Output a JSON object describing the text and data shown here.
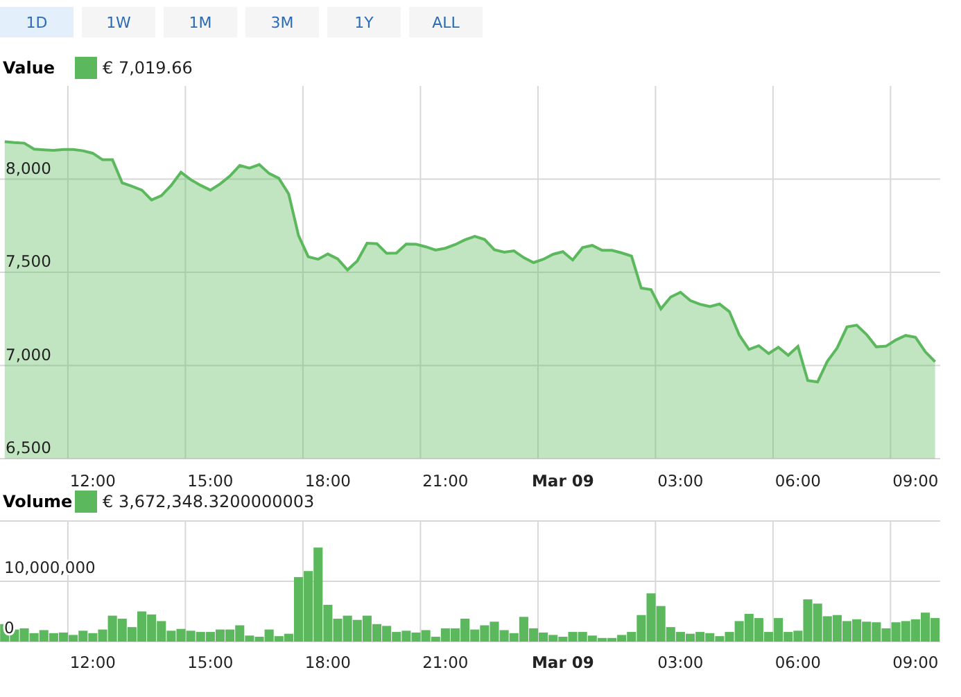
{
  "range_buttons": [
    {
      "label": "1D",
      "selected": true
    },
    {
      "label": "1W",
      "selected": false
    },
    {
      "label": "1M",
      "selected": false
    },
    {
      "label": "3M",
      "selected": false
    },
    {
      "label": "1Y",
      "selected": false
    },
    {
      "label": "ALL",
      "selected": false
    }
  ],
  "value_panel": {
    "legend_value": "€ 7,019.66",
    "chart_data": {
      "type": "area",
      "grid": true,
      "ylim": [
        6500,
        8500
      ],
      "yticks": [
        {
          "value": 6500,
          "label": "6,500"
        },
        {
          "value": 7000,
          "label": "7,000"
        },
        {
          "value": 7500,
          "label": "7,500"
        },
        {
          "value": 8000,
          "label": "8,000"
        }
      ],
      "categories": [
        null,
        null,
        null,
        null,
        null,
        null,
        null,
        null,
        null,
        "12:00",
        null,
        null,
        null,
        null,
        null,
        null,
        null,
        null,
        null,
        null,
        null,
        "15:00",
        null,
        null,
        null,
        null,
        null,
        null,
        null,
        null,
        null,
        null,
        null,
        "18:00",
        null,
        null,
        null,
        null,
        null,
        null,
        null,
        null,
        null,
        null,
        null,
        "21:00",
        null,
        null,
        null,
        null,
        null,
        null,
        null,
        null,
        null,
        null,
        null,
        "Mar 09",
        null,
        null,
        null,
        null,
        null,
        null,
        null,
        null,
        null,
        null,
        null,
        "03:00",
        null,
        null,
        null,
        null,
        null,
        null,
        null,
        null,
        null,
        null,
        null,
        "06:00",
        null,
        null,
        null,
        null,
        null,
        null,
        null,
        null,
        null,
        null,
        null,
        "09:00",
        null,
        null
      ],
      "series": [
        {
          "name": "Value",
          "color": "#5cb85c",
          "values": [
            8200,
            8196,
            8193,
            8161,
            8157,
            8154,
            8159,
            8159,
            8152,
            8139,
            8104,
            8104,
            7980,
            7962,
            7941,
            7888,
            7911,
            7966,
            8037,
            7997,
            7967,
            7941,
            7974,
            8017,
            8073,
            8059,
            8078,
            8030,
            8004,
            7920,
            7696,
            7583,
            7570,
            7598,
            7572,
            7513,
            7560,
            7656,
            7653,
            7602,
            7603,
            7652,
            7650,
            7637,
            7619,
            7629,
            7649,
            7674,
            7693,
            7676,
            7621,
            7608,
            7615,
            7579,
            7552,
            7570,
            7597,
            7611,
            7566,
            7632,
            7644,
            7618,
            7618,
            7604,
            7587,
            7415,
            7407,
            7304,
            7367,
            7393,
            7348,
            7328,
            7316,
            7330,
            7289,
            7163,
            7086,
            7106,
            7064,
            7098,
            7055,
            7102,
            6919,
            6912,
            7022,
            7094,
            7207,
            7216,
            7166,
            7100,
            7104,
            7137,
            7161,
            7151,
            7073,
            7020
          ]
        }
      ]
    }
  },
  "volume_panel": {
    "legend_value": "€ 3,672,348.3200000003",
    "chart_data": {
      "type": "bar",
      "grid": true,
      "ylim": [
        0,
        20000000
      ],
      "yticks": [
        {
          "value": 0,
          "label": "0"
        },
        {
          "value": 10000000,
          "label": "10,000,000"
        }
      ],
      "categories": [
        null,
        null,
        null,
        null,
        null,
        null,
        null,
        null,
        null,
        "12:00",
        null,
        null,
        null,
        null,
        null,
        null,
        null,
        null,
        null,
        null,
        null,
        "15:00",
        null,
        null,
        null,
        null,
        null,
        null,
        null,
        null,
        null,
        null,
        null,
        "18:00",
        null,
        null,
        null,
        null,
        null,
        null,
        null,
        null,
        null,
        null,
        null,
        "21:00",
        null,
        null,
        null,
        null,
        null,
        null,
        null,
        null,
        null,
        null,
        null,
        "Mar 09",
        null,
        null,
        null,
        null,
        null,
        null,
        null,
        null,
        null,
        null,
        null,
        "03:00",
        null,
        null,
        null,
        null,
        null,
        null,
        null,
        null,
        null,
        null,
        null,
        "06:00",
        null,
        null,
        null,
        null,
        null,
        null,
        null,
        null,
        null,
        null,
        null,
        "09:00",
        null,
        null
      ],
      "series": [
        {
          "name": "Volume",
          "color": "#5cb85c",
          "values": [
            2900000,
            2000000,
            2200000,
            1400000,
            1900000,
            1400000,
            1500000,
            1100000,
            1800000,
            1400000,
            2000000,
            4300000,
            3800000,
            2400000,
            5000000,
            4500000,
            3400000,
            1800000,
            2100000,
            1800000,
            1600000,
            1600000,
            2000000,
            2000000,
            2700000,
            1000000,
            800000,
            2000000,
            900000,
            1300000,
            10700000,
            11700000,
            15600000,
            6100000,
            3800000,
            4300000,
            3600000,
            4300000,
            2900000,
            2600000,
            1600000,
            1800000,
            1500000,
            1900000,
            800000,
            2200000,
            2200000,
            3800000,
            2000000,
            2700000,
            3300000,
            1900000,
            1400000,
            4100000,
            2200000,
            1500000,
            1100000,
            800000,
            1600000,
            1600000,
            1000000,
            600000,
            600000,
            1100000,
            1600000,
            4400000,
            8000000,
            5900000,
            2400000,
            1600000,
            1300000,
            1600000,
            1400000,
            900000,
            1600000,
            3400000,
            4600000,
            3900000,
            1600000,
            3900000,
            1600000,
            1800000,
            7000000,
            6300000,
            4200000,
            4400000,
            3400000,
            3700000,
            3300000,
            3200000,
            2200000,
            3200000,
            3400000,
            3700000,
            4800000,
            3900000
          ]
        }
      ]
    }
  }
}
